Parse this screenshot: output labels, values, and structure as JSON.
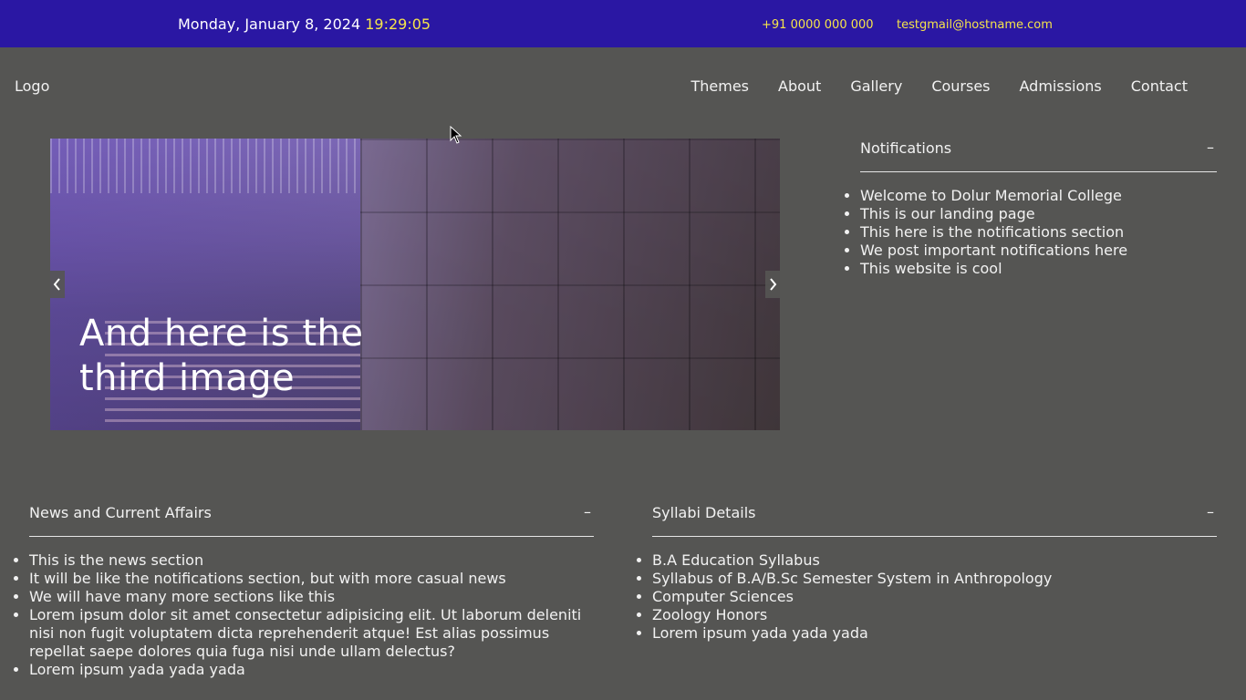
{
  "topbar": {
    "date": "Monday, January 8, 2024",
    "time": "19:29:05",
    "phone": "+91 0000 000 000",
    "email": "testgmail@hostname.com"
  },
  "header": {
    "logo": "Logo",
    "nav": [
      "Themes",
      "About",
      "Gallery",
      "Courses",
      "Admissions",
      "Contact"
    ]
  },
  "carousel": {
    "caption": "And here is the third image",
    "prev_icon": "chevron-left-icon",
    "next_icon": "chevron-right-icon"
  },
  "notifications": {
    "title": "Notifications",
    "toggle": "–",
    "items": [
      "Welcome to Dolur Memorial College",
      "This is our landing page",
      "This here is the notifications section",
      "We post important notifications here",
      "This website is cool"
    ]
  },
  "news": {
    "title": "News and Current Affairs",
    "toggle": "–",
    "items": [
      "This is the news section",
      "It will be like the notifications section, but with more casual news",
      "We will have many more sections like this",
      "Lorem ipsum dolor sit amet consectetur adipisicing elit. Ut laborum deleniti nisi non fugit voluptatem dicta reprehenderit atque! Est alias possimus repellat saepe dolores quia fuga nisi unde ullam delectus?",
      "Lorem ipsum yada yada yada"
    ]
  },
  "syllabi": {
    "title": "Syllabi Details",
    "toggle": "–",
    "items": [
      "B.A Education Syllabus",
      "Syllabus of B.A/B.Sc Semester System in Anthropology",
      "Computer Sciences",
      "Zoology Honors",
      "Lorem ipsum yada yada yada"
    ]
  },
  "colors": {
    "topbar": "#2a17a3",
    "accent": "#f5e44a",
    "background": "#555553"
  }
}
